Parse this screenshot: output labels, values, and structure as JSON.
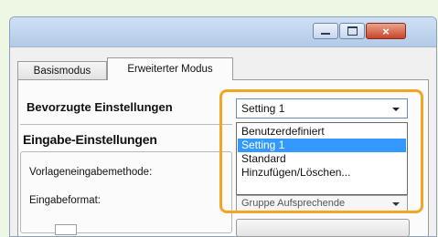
{
  "window": {
    "buttons": [
      {
        "name": "minimize",
        "glyph": "minimize-icon"
      },
      {
        "name": "maximize",
        "glyph": "maximize-icon"
      },
      {
        "name": "close",
        "glyph": "close-icon",
        "label": "×"
      }
    ]
  },
  "tabs": [
    {
      "label": "Basismodus",
      "active": false
    },
    {
      "label": "Erweiterter Modus",
      "active": true
    }
  ],
  "preferred": {
    "label": "Bevorzugte Einstellungen",
    "selected": "Setting 1",
    "options": [
      "Benutzerdefiniert",
      "Setting 1",
      "Standard",
      "Hinzufügen/Löschen..."
    ],
    "selected_index": 1
  },
  "input_settings": {
    "heading": "Eingabe-Einstellungen",
    "template_method_label": "Vorlageneingabemethode:",
    "input_format_label": "Eingabeformat:",
    "partial_combo_text": "Gruppe Aufsprechende"
  },
  "colors": {
    "highlight": "#f5a524",
    "selection": "#3399ff",
    "background": "#eef6e4"
  }
}
